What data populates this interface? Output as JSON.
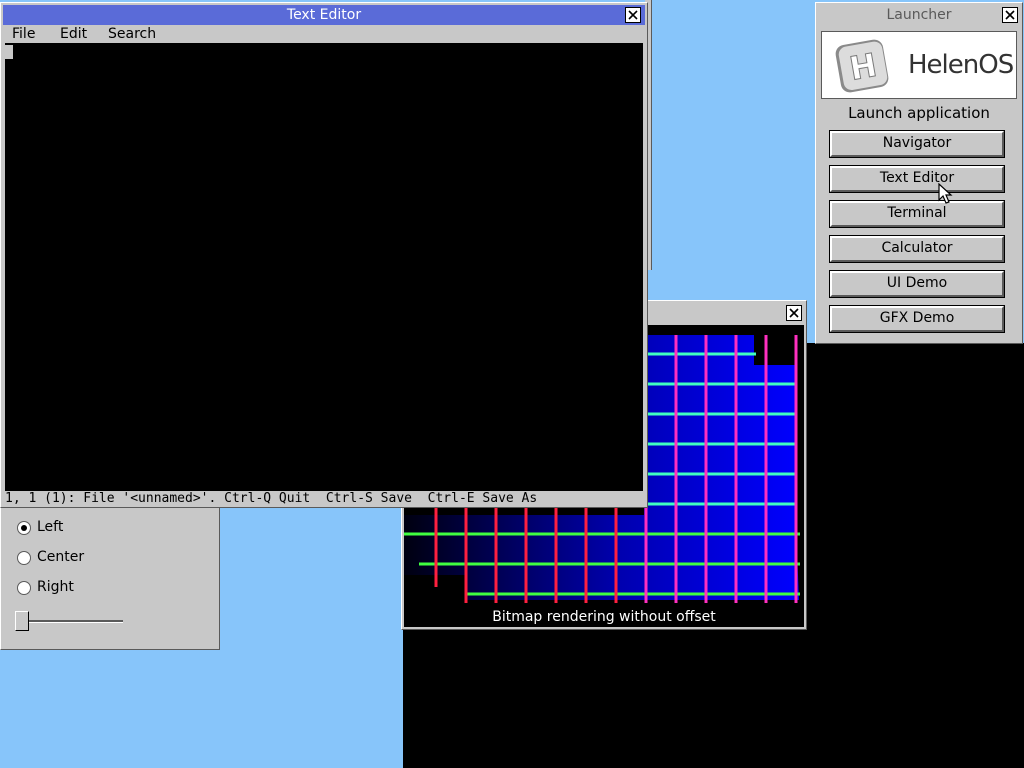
{
  "desktop": {
    "background": "#87c5fa"
  },
  "text_editor": {
    "title": "Text Editor",
    "menu": [
      "File",
      "Edit",
      "Search"
    ],
    "status": "1, 1 (1): File '<unnamed>'. Ctrl-Q Quit  Ctrl-S Save  Ctrl-E Save As",
    "title_color": "#5a6bd8"
  },
  "ui_demo": {
    "options": [
      {
        "label": "Left",
        "selected": true
      },
      {
        "label": "Center",
        "selected": false
      },
      {
        "label": "Right",
        "selected": false
      }
    ],
    "slider_value": 0
  },
  "gfx_demo": {
    "caption": "Bitmap rendering without offset"
  },
  "launcher": {
    "title": "Launcher",
    "logo_text": "HelenOS",
    "heading": "Launch application",
    "apps": [
      "Navigator",
      "Text Editor",
      "Terminal",
      "Calculator",
      "UI Demo",
      "GFX Demo"
    ]
  }
}
